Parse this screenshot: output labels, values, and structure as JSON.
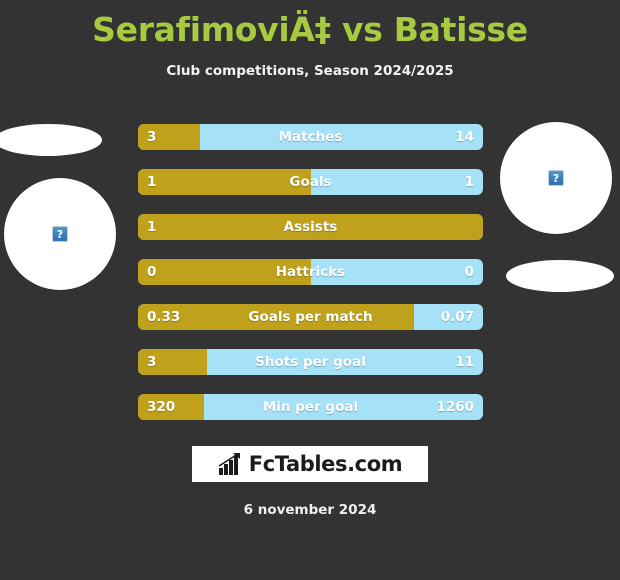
{
  "header": {
    "title": "SerafimoviÄ‡ vs Batisse",
    "subtitle": "Club competitions, Season 2024/2025",
    "title_color": "#a7ca41"
  },
  "theme": {
    "background": "#333333",
    "home_color": "#bfa11c",
    "away_color": "#a5e1f7",
    "text_color": "#ffffff"
  },
  "players": {
    "home": {
      "crest_placeholder": "broken-image-icon",
      "flag_placeholder": "broken-image-icon"
    },
    "away": {
      "crest_placeholder": "broken-image-icon",
      "flag_placeholder": "broken-image-icon"
    }
  },
  "chart_data": {
    "type": "bar",
    "title": "SerafimoviÄ‡ vs Batisse",
    "subtitle": "Club competitions, Season 2024/2025",
    "orientation": "horizontal-diverging",
    "series": [
      {
        "name": "SerafimoviÄ‡",
        "color": "#bfa11c",
        "values": [
          3,
          1,
          1,
          0,
          0.33,
          3,
          320
        ]
      },
      {
        "name": "Batisse",
        "color": "#a5e1f7",
        "values": [
          14,
          1,
          null,
          0,
          0.07,
          11,
          1260
        ]
      }
    ],
    "categories": [
      "Matches",
      "Goals",
      "Assists",
      "Hattricks",
      "Goals per match",
      "Shots per goal",
      "Min per goal"
    ],
    "rows": [
      {
        "label": "Matches",
        "home": "3",
        "away": "14",
        "home_pct": 18
      },
      {
        "label": "Goals",
        "home": "1",
        "away": "1",
        "home_pct": 50
      },
      {
        "label": "Assists",
        "home": "1",
        "away": "",
        "home_pct": 100
      },
      {
        "label": "Hattricks",
        "home": "0",
        "away": "0",
        "home_pct": 50
      },
      {
        "label": "Goals per match",
        "home": "0.33",
        "away": "0.07",
        "home_pct": 80
      },
      {
        "label": "Shots per goal",
        "home": "3",
        "away": "11",
        "home_pct": 20
      },
      {
        "label": "Min per goal",
        "home": "320",
        "away": "1260",
        "home_pct": 19
      }
    ]
  },
  "footer": {
    "logo_text": "FcTables.com",
    "logo_icon": "bar-chart-icon",
    "date": "6 november 2024"
  }
}
